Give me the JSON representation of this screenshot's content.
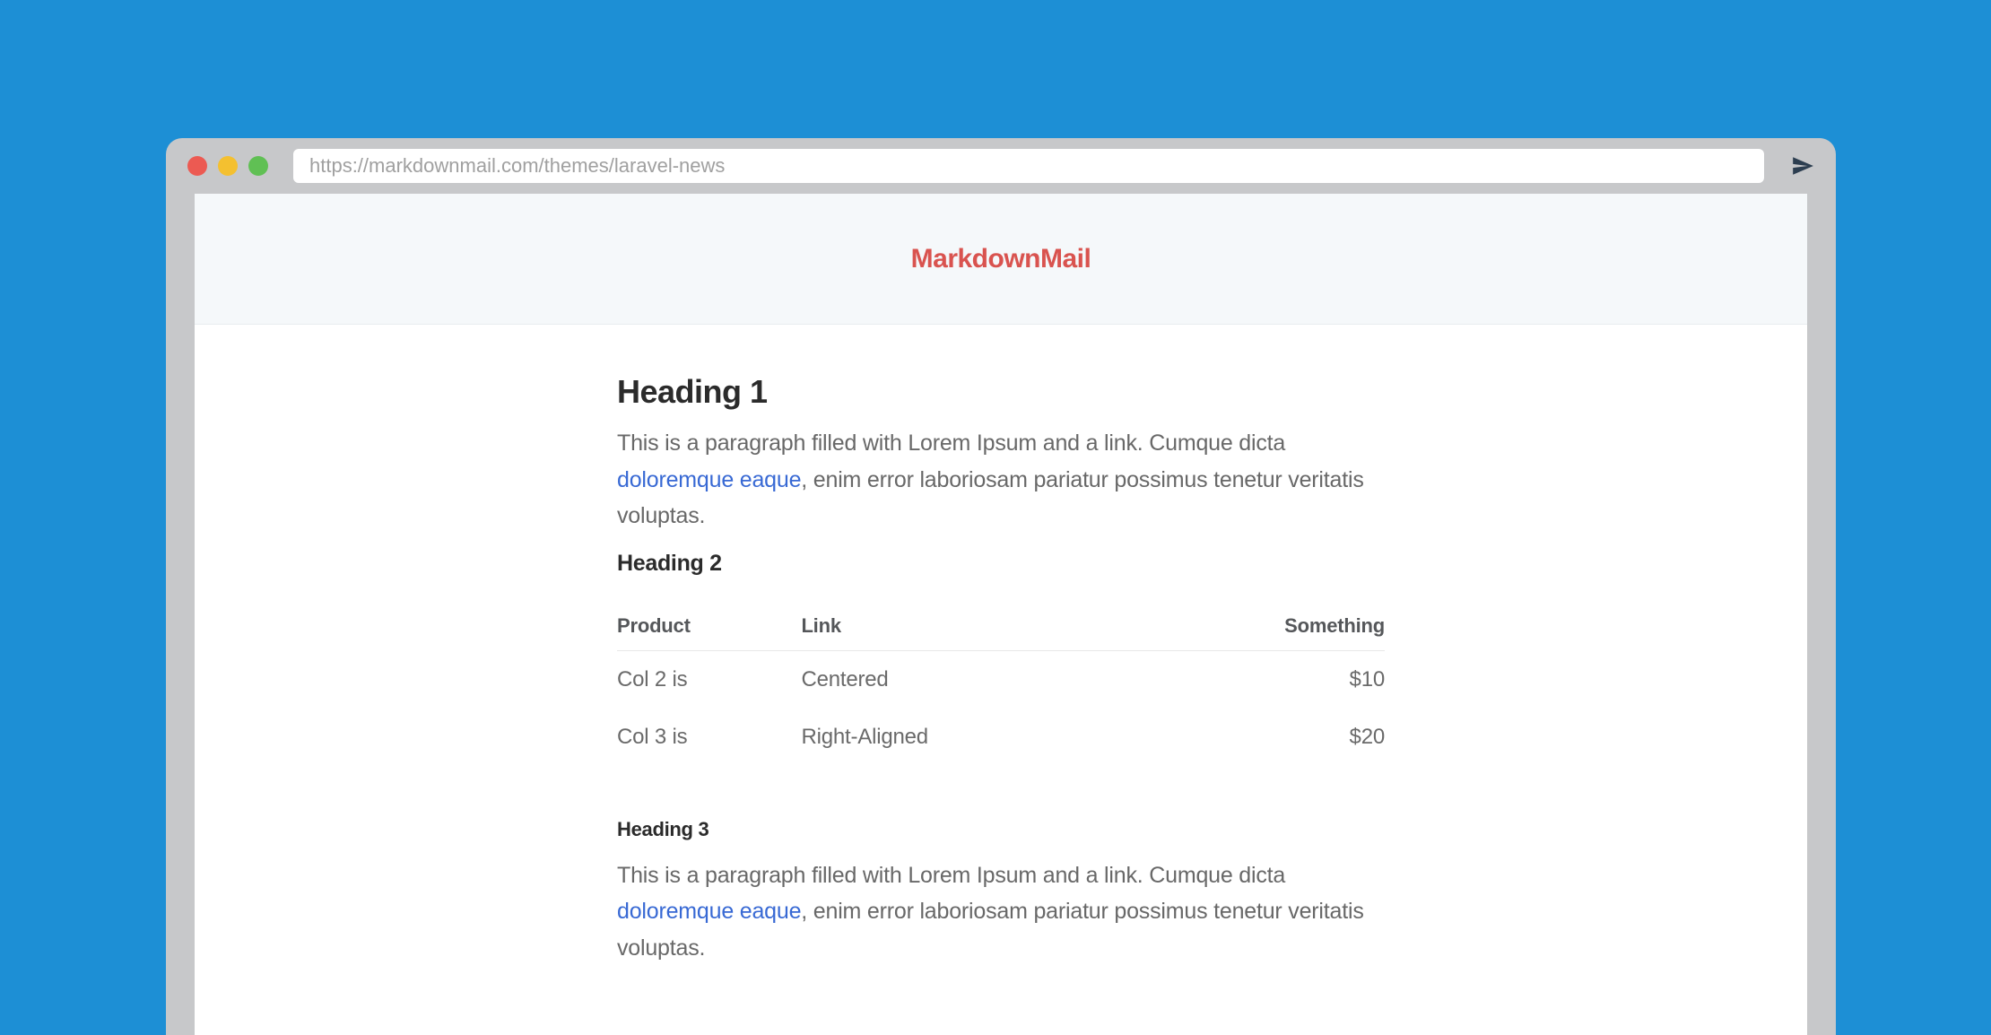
{
  "browser": {
    "url": "https://markdownmail.com/themes/laravel-news"
  },
  "header": {
    "brand": "MarkdownMail"
  },
  "content": {
    "heading1": "Heading 1",
    "paragraph1_before": "This is a paragraph filled with Lorem Ipsum and a link. Cumque dicta ",
    "paragraph1_link": "doloremque eaque",
    "paragraph1_after": ", enim error laboriosam pariatur possimus tenetur veritatis voluptas.",
    "heading2": "Heading 2",
    "table": {
      "headers": [
        "Product",
        "Link",
        "Something"
      ],
      "rows": [
        [
          "Col 2 is",
          "Centered",
          "$10"
        ],
        [
          "Col 3 is",
          "Right-Aligned",
          "$20"
        ]
      ]
    },
    "heading3": "Heading 3",
    "paragraph2_before": "This is a paragraph filled with Lorem Ipsum and a link. Cumque dicta ",
    "paragraph2_link": "doloremque eaque",
    "paragraph2_after": ", enim error laboriosam pariatur possimus tenetur veritatis voluptas."
  }
}
